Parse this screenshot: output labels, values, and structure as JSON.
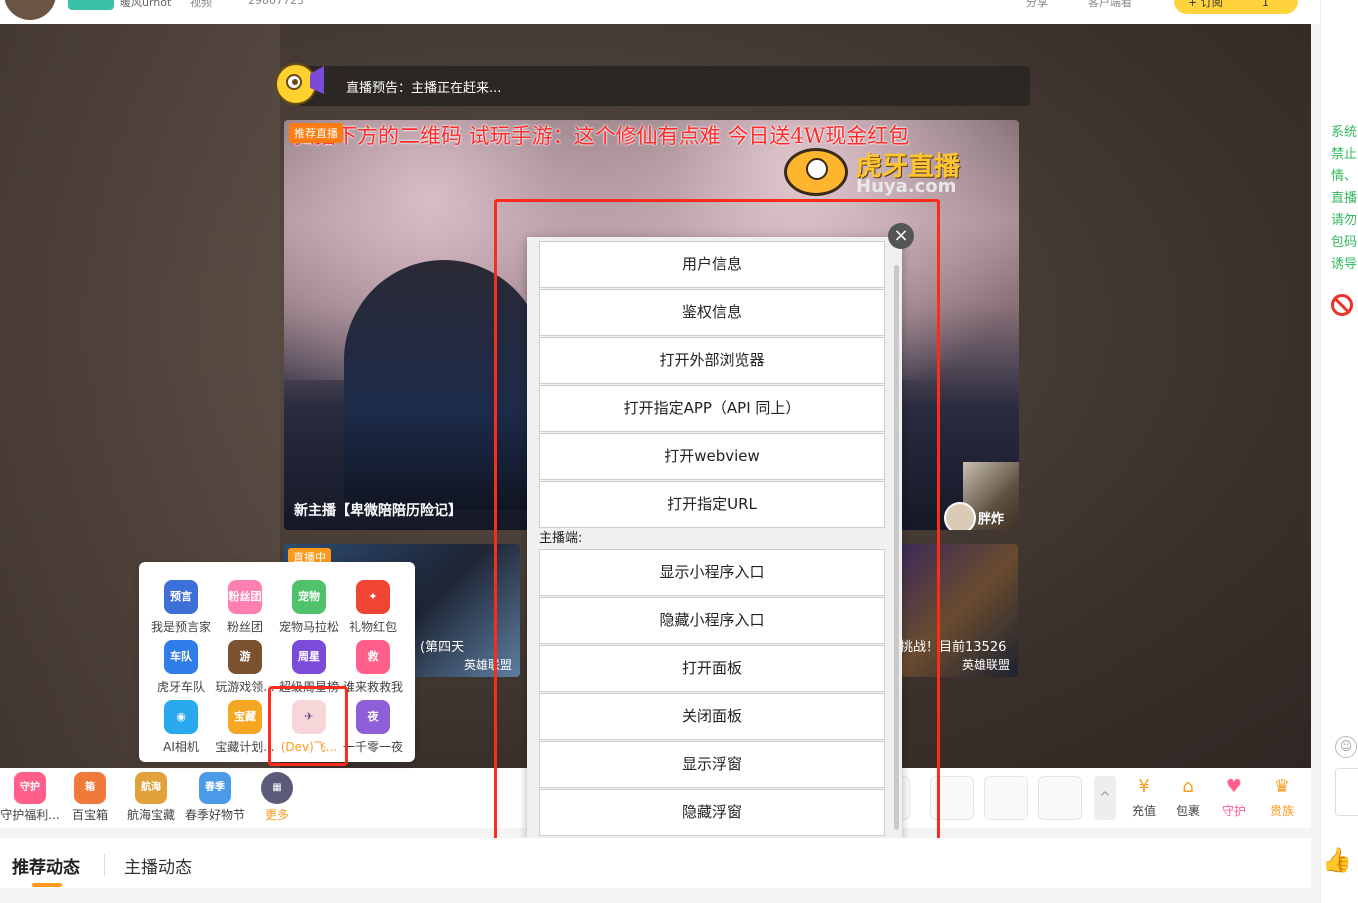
{
  "topbar": {
    "streamer_name": "暖风urhot",
    "video_tag": "视频",
    "room_id": "29807723",
    "share": "分享",
    "client_watch": "客户端看",
    "subscribe": "+ 订阅",
    "subscribe_count": "1"
  },
  "player": {
    "preview_text": "直播预告：主播正在赶来...",
    "recommend_tag": "推荐直播",
    "marquee": "扫描下方的二维码 试玩手游：这个修仙有点难 今日送4W现金红包",
    "logo_cn": "虎牙直播",
    "logo_en": "Huya.com",
    "card_title": "新主播【卑微陪陪历险记】",
    "side_name": "胖炸",
    "thumb_a": {
      "live": "直播中",
      "caption": "(第四天",
      "game": "英雄联盟"
    },
    "thumb_b": {
      "caption": "挑战！目前13526",
      "game": "英雄联盟"
    }
  },
  "modal": {
    "items_viewer": [
      "用户信息",
      "鉴权信息",
      "打开外部浏览器",
      "打开指定APP（API 同上）",
      "打开webview",
      "打开指定URL"
    ],
    "section_label": "主播端:",
    "items_streamer": [
      "显示小程序入口",
      "隐藏小程序入口",
      "打开面板",
      "关闭面板",
      "显示浮窗",
      "隐藏浮窗"
    ],
    "close": "×"
  },
  "more_panel": {
    "items": [
      {
        "label": "我是预言家",
        "icon": "prophet-icon",
        "text": "预言",
        "color": "#3d6fd8"
      },
      {
        "label": "粉丝团",
        "icon": "fan-club-icon",
        "text": "粉丝团",
        "color": "#ff7fb0"
      },
      {
        "label": "宠物马拉松",
        "icon": "pet-marathon-icon",
        "text": "宠物",
        "color": "#4fc26b"
      },
      {
        "label": "礼物红包",
        "icon": "red-envelope-icon",
        "text": "✦",
        "color": "#f04532"
      },
      {
        "label": "虎牙车队",
        "icon": "team-icon",
        "text": "车队",
        "color": "#2f7de8"
      },
      {
        "label": "玩游戏领...",
        "icon": "game-reward-icon",
        "text": "游",
        "color": "#7a5230"
      },
      {
        "label": "超级周星榜",
        "icon": "weekly-star-icon",
        "text": "周星",
        "color": "#7b4bd9"
      },
      {
        "label": "谁来救救我",
        "icon": "rescue-icon",
        "text": "救",
        "color": "#ff5f8a"
      },
      {
        "label": "AI相机",
        "icon": "camera-icon",
        "text": "◉",
        "color": "#29a8ee"
      },
      {
        "label": "宝藏计划...",
        "icon": "treasure-plan-icon",
        "text": "宝藏",
        "color": "#f5a623"
      },
      {
        "label": "(Dev)飞...",
        "icon": "dev-app-icon",
        "text": "✈",
        "color": "#f7d6d9"
      },
      {
        "label": "一千零一夜",
        "icon": "arabian-nights-icon",
        "text": "夜",
        "color": "#8e5fd9"
      }
    ]
  },
  "gift_bar": {
    "left_items": [
      {
        "label": "守护福利...",
        "icon": "guard-benefit-icon",
        "text": "守护",
        "color": "#ff5f8a"
      },
      {
        "label": "百宝箱",
        "icon": "treasure-box-icon",
        "text": "箱",
        "color": "#f07a3a"
      },
      {
        "label": "航海宝藏",
        "icon": "voyage-treasure-icon",
        "text": "航海",
        "color": "#e2a13a"
      },
      {
        "label": "春季好物节",
        "icon": "spring-festival-icon",
        "text": "春季",
        "color": "#4a9ae8"
      },
      {
        "label": "更多",
        "icon": "more-grid-icon",
        "text": "▦",
        "color": "#5a5a7a"
      }
    ],
    "right_items": [
      {
        "label": "充值",
        "icon": "recharge-icon",
        "glyph": "¥",
        "color": "#ff9a1c"
      },
      {
        "label": "包裹",
        "icon": "package-icon",
        "glyph": "⌂",
        "color": "#ff9a1c"
      },
      {
        "label": "守护",
        "icon": "guard-icon",
        "glyph": "♥",
        "color": "#ff5f8a"
      },
      {
        "label": "贵族",
        "icon": "noble-icon",
        "glyph": "♛",
        "color": "#ff9a1c"
      }
    ],
    "collapse": "^"
  },
  "feed_tabs": {
    "recommend": "推荐动态",
    "streamer": "主播动态"
  },
  "chat": {
    "notice_lines": [
      "系统",
      "禁止",
      "情、",
      "直播",
      "请勿",
      "包码",
      "诱导"
    ]
  }
}
